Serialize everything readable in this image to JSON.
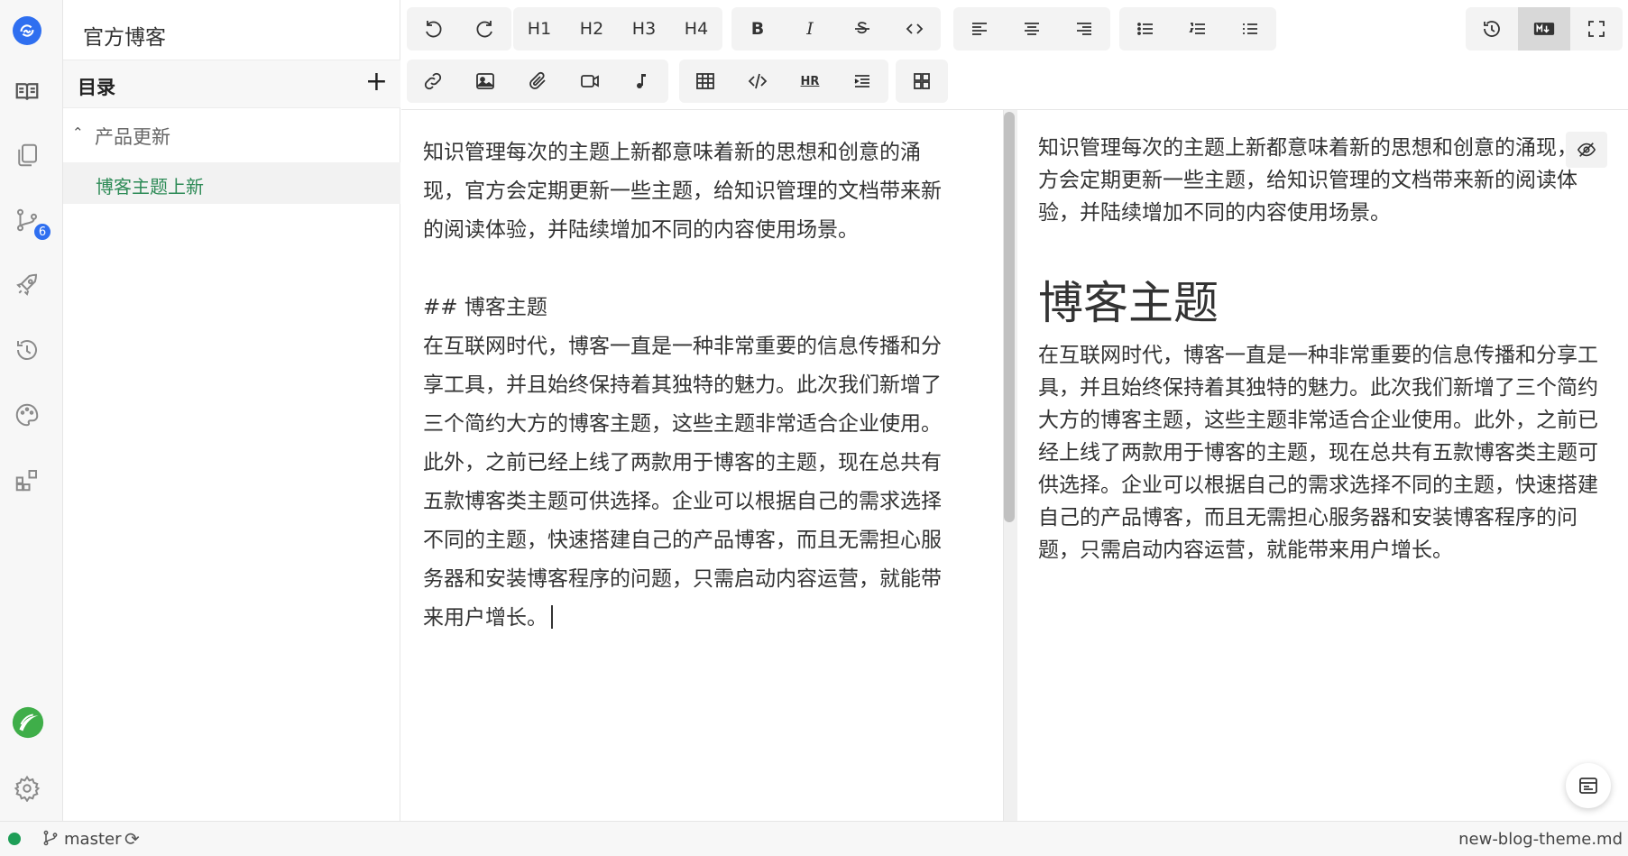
{
  "app": {
    "title": "官方博客"
  },
  "activity_bar": {
    "items": [
      {
        "name": "book-icon"
      },
      {
        "name": "copy-icon"
      },
      {
        "name": "git-branch-icon",
        "badge": "6"
      },
      {
        "name": "rocket-icon"
      },
      {
        "name": "history-icon"
      },
      {
        "name": "palette-icon"
      },
      {
        "name": "extensions-icon"
      }
    ]
  },
  "sidebar": {
    "header": "目录",
    "folder": "产品更新",
    "file": "博客主题上新"
  },
  "toolbar": {
    "h1": "H1",
    "h2": "H2",
    "h3": "H3",
    "h4": "H4",
    "bold": "B",
    "italic": "I",
    "hr": "HR"
  },
  "editor": {
    "text": "知识管理每次的主题上新都意味着新的思想和创意的涌\n现，官方会定期更新一些主题，给知识管理的文档带来新\n的阅读体验，并陆续增加不同的内容使用场景。\n\n## 博客主题\n在互联网时代，博客一直是一种非常重要的信息传播和分\n享工具，并且始终保持着其独特的魅力。此次我们新增了\n三个简约大方的博客主题，这些主题非常适合企业使用。\n此外，之前已经上线了两款用于博客的主题，现在总共有\n五款博客类主题可供选择。企业可以根据自己的需求选择\n不同的主题，快速搭建自己的产品博客，而且无需担心服\n务器和安装博客程序的问题，只需启动内容运营，就能带\n来用户增长。"
  },
  "preview": {
    "paragraph1": "知识管理每次的主题上新都意味着新的思想和创意的涌现，官方会定期更新一些主题，给知识管理的文档带来新的阅读体验，并陆续增加不同的内容使用场景。",
    "heading": "博客主题",
    "paragraph2": "在互联网时代，博客一直是一种非常重要的信息传播和分享工具，并且始终保持着其独特的魅力。此次我们新增了三个简约大方的博客主题，这些主题非常适合企业使用。此外，之前已经上线了两款用于博客的主题，现在总共有五款博客类主题可供选择。企业可以根据自己的需求选择不同的主题，快速搭建自己的产品博客，而且无需担心服务器和安装博客程序的问题，只需启动内容运营，就能带来用户增长。"
  },
  "statusbar": {
    "branch": "master",
    "filename": "new-blog-theme.md",
    "status_color": "#1e9e57"
  },
  "colors": {
    "accent": "#2f6ff0",
    "active_file": "#2e8b57"
  }
}
